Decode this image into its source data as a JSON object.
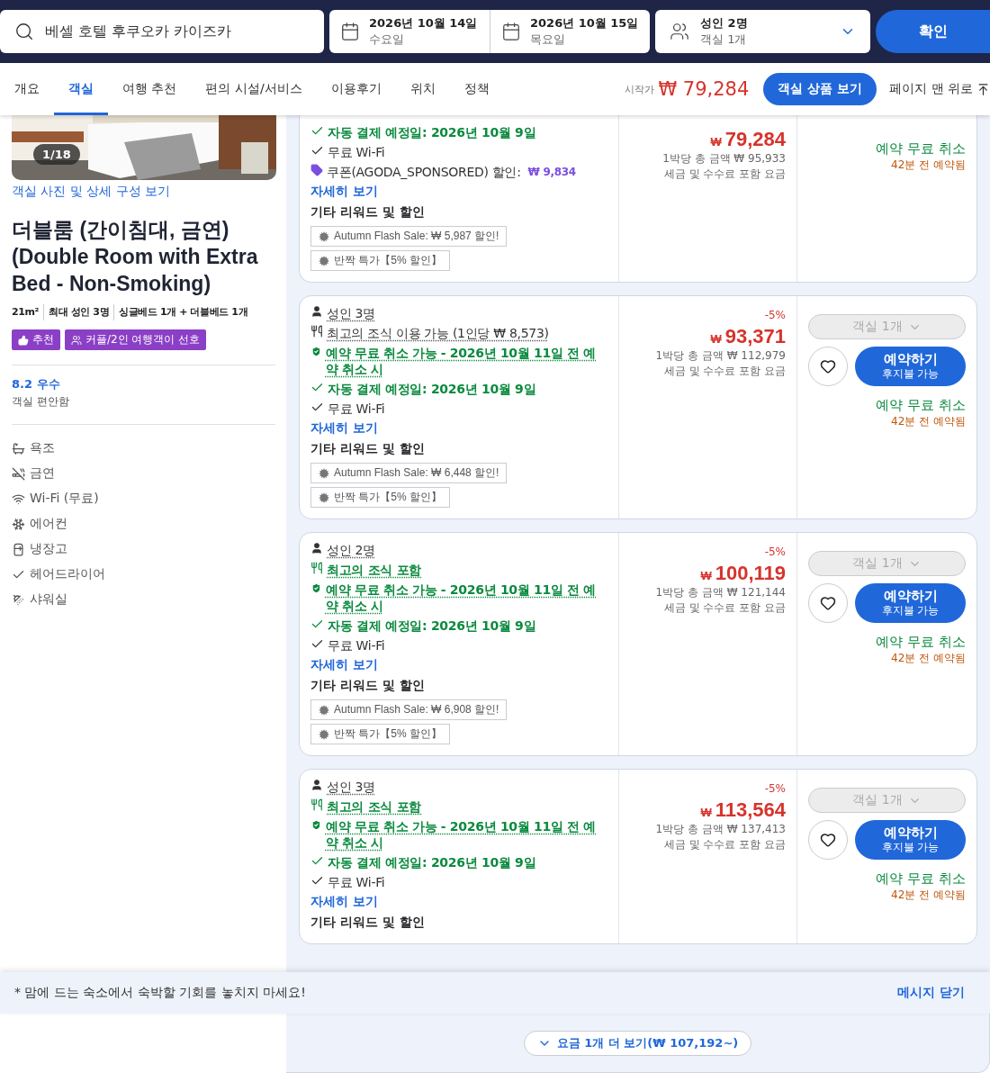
{
  "search_bar": {
    "destination": "베셀 호텔 후쿠오카 카이즈카",
    "dates": [
      {
        "date": "2026년 10월 14일",
        "weekday": "수요일",
        "kind": "checkin"
      },
      {
        "date": "2026년 10월 15일",
        "weekday": "목요일",
        "kind": "checkout"
      }
    ],
    "guests": {
      "adults": "성인 2명",
      "rooms": "객실 1개"
    },
    "confirm": "확인"
  },
  "tabs": [
    {
      "label": "개요",
      "selected": false
    },
    {
      "label": "객실",
      "selected": true
    },
    {
      "label": "여행 추천",
      "selected": false
    },
    {
      "label": "편의 시설/서비스",
      "selected": false
    },
    {
      "label": "이용후기",
      "selected": false
    },
    {
      "label": "위치",
      "selected": false
    },
    {
      "label": "정책",
      "selected": false
    }
  ],
  "tab_bar_right": {
    "price_prefix": "시작가",
    "price": "₩ 79,284",
    "offers_button": "객실 상품 보기",
    "top_link": "페이지 맨 위로"
  },
  "room": {
    "photo_counter": "1/18",
    "photo_link": "객실 사진 및 상세 구성 보기",
    "title": "더블룸 (간이침대, 금연) (Double Room with Extra Bed - Non-Smoking)",
    "specs": [
      "21m²",
      "최대 성인 3명",
      "싱글베드 1개 + 더블베드 1개"
    ],
    "tags": [
      {
        "label": "추천",
        "kind": "recommended"
      },
      {
        "label": "커플/2인 여행객이 선호",
        "kind": "couple"
      }
    ],
    "rating": "8.2 우수",
    "rating_label": "객실 편안함",
    "amenities": [
      {
        "label": "욕조",
        "kind": "bathtub"
      },
      {
        "label": "금연",
        "kind": "nosmoking"
      },
      {
        "label": "Wi-Fi (무료)",
        "kind": "wifi"
      },
      {
        "label": "에어컨",
        "kind": "aircon"
      },
      {
        "label": "냉장고",
        "kind": "fridge"
      },
      {
        "label": "헤어드라이어",
        "kind": "check"
      },
      {
        "label": "샤워실",
        "kind": "shower"
      }
    ]
  },
  "offers": [
    {
      "features": [
        {
          "kind": "autopay",
          "text": "자동 결제 예정일: 2026년 10월 9일"
        },
        {
          "kind": "wifi",
          "text": "무료 Wi-Fi"
        },
        {
          "kind": "coupon",
          "text": "쿠폰(AGODA_SPONSORED) 할인:",
          "amount": "₩ 9,834"
        }
      ],
      "details_link": "자세히 보기",
      "rewards_title": "기타 리워드 및 할인",
      "rewards": [
        "Autumn Flash Sale: ₩ 5,987 할인!",
        "반짝 특가【5% 할인】"
      ],
      "currency": "₩",
      "price": "79,284",
      "total": "1박당 총 금액 ₩ 95,933",
      "tax_note": "세금 및 수수료 포함 요금",
      "free_cancel": "예약 무료 취소",
      "booked_ago": "42분 전 예약됨"
    },
    {
      "features": [
        {
          "kind": "occupancy",
          "text": "성인 3명"
        },
        {
          "kind": "meal",
          "text": "최고의 조식 이용 가능 (1인당 ₩ 8,573)"
        },
        {
          "kind": "cancel",
          "text": "예약 무료 취소 가능 - 2026년 10월 11일 전 예약 취소 시"
        },
        {
          "kind": "autopay",
          "text": "자동 결제 예정일: 2026년 10월 9일"
        },
        {
          "kind": "wifi",
          "text": "무료 Wi-Fi"
        }
      ],
      "details_link": "자세히 보기",
      "rewards_title": "기타 리워드 및 할인",
      "rewards": [
        "Autumn Flash Sale: ₩ 6,448 할인!",
        "반짝 특가【5% 할인】"
      ],
      "discount": "-5%",
      "currency": "₩",
      "price": "93,371",
      "total": "1박당 총 금액 ₩ 112,979",
      "tax_note": "세금 및 수수료 포함 요금",
      "rooms_select": {
        "label": "객실 1개",
        "disabled": true
      },
      "book_button": {
        "label": "예약하기",
        "sub": "후지불 가능"
      },
      "free_cancel": "예약 무료 취소",
      "booked_ago": "42분 전 예약됨"
    },
    {
      "features": [
        {
          "kind": "occupancy",
          "text": "성인 2명"
        },
        {
          "kind": "meal_included",
          "text": "최고의 조식 포함"
        },
        {
          "kind": "cancel",
          "text": "예약 무료 취소 가능 - 2026년 10월 11일 전 예약 취소 시"
        },
        {
          "kind": "autopay",
          "text": "자동 결제 예정일: 2026년 10월 9일"
        },
        {
          "kind": "wifi",
          "text": "무료 Wi-Fi"
        }
      ],
      "details_link": "자세히 보기",
      "rewards_title": "기타 리워드 및 할인",
      "rewards": [
        "Autumn Flash Sale: ₩ 6,908 할인!",
        "반짝 특가【5% 할인】"
      ],
      "discount": "-5%",
      "currency": "₩",
      "price": "100,119",
      "total": "1박당 총 금액 ₩ 121,144",
      "tax_note": "세금 및 수수료 포함 요금",
      "rooms_select": {
        "label": "객실 1개",
        "disabled": true
      },
      "book_button": {
        "label": "예약하기",
        "sub": "후지불 가능"
      },
      "free_cancel": "예약 무료 취소",
      "booked_ago": "42분 전 예약됨"
    },
    {
      "features": [
        {
          "kind": "occupancy",
          "text": "성인 3명"
        },
        {
          "kind": "meal_included",
          "text": "최고의 조식 포함"
        },
        {
          "kind": "cancel",
          "text": "예약 무료 취소 가능 - 2026년 10월 11일 전 예약 취소 시"
        },
        {
          "kind": "autopay",
          "text": "자동 결제 예정일: 2026년 10월 9일"
        },
        {
          "kind": "wifi",
          "text": "무료 Wi-Fi"
        }
      ],
      "details_link": "자세히 보기",
      "rewards_title": "기타 리워드 및 할인",
      "discount": "-5%",
      "currency": "₩",
      "price": "113,564",
      "total": "1박당 총 금액 ₩ 137,413",
      "tax_note": "세금 및 수수료 포함 요금",
      "rooms_select": {
        "label": "객실 1개",
        "disabled": true
      },
      "book_button": {
        "label": "예약하기",
        "sub": "후지불 가능"
      },
      "free_cancel": "예약 무료 취소",
      "booked_ago": "42분 전 예약됨"
    }
  ],
  "banner": {
    "message": "* 맘에 드는 숙소에서 숙박할 기회를 놓치지 마세요!",
    "close": "메시지 닫기"
  },
  "more_rates": "요금 1개 더 보기(₩ 107,192~)"
}
